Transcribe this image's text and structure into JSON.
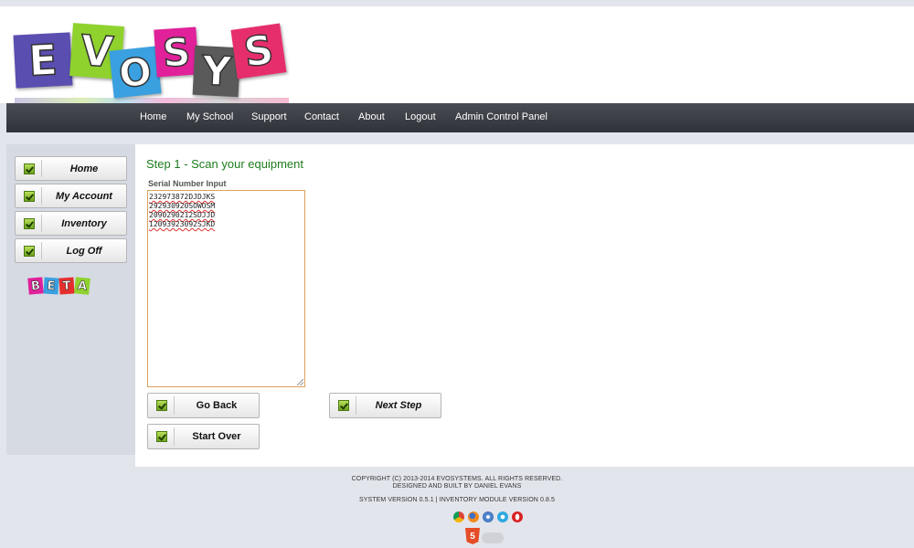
{
  "header": {
    "logo_letters": [
      "E",
      "V",
      "O",
      "S",
      "Y",
      "S"
    ],
    "logo_colors": [
      "#5a4eb0",
      "#8fd22e",
      "#3aa0e0",
      "#e0219a",
      "#5a5a5a",
      "#e72e6d"
    ]
  },
  "nav": {
    "items": [
      "Home",
      "My School",
      "Support",
      "Contact",
      "About",
      "Logout",
      "Admin Control Panel"
    ]
  },
  "sidebar": {
    "items": [
      "Home",
      "My Account",
      "Inventory",
      "Log Off"
    ],
    "beta_letters": [
      "B",
      "E",
      "T",
      "A"
    ],
    "beta_colors": [
      "#e0219a",
      "#3aa0e0",
      "#e72e2e",
      "#8fd22e"
    ]
  },
  "main": {
    "step_title": "Step 1 - Scan your equipment",
    "field_label": "Serial Number Input",
    "serials": [
      "232973872DJDJKS",
      "292930920SOWOSM",
      "2090290212SDJJD",
      "12093923092SJKD"
    ],
    "buttons": {
      "go_back": "Go Back",
      "next_step": "Next Step",
      "start_over": "Start Over"
    }
  },
  "footer": {
    "copyright": "COPYRIGHT (C) 2013-2014 EVOSYSTEMS. ALL RIGHTS RESERVED.",
    "designed_by": "DESIGNED AND BUILT BY DANIEL EVANS",
    "version": "SYSTEM VERSION 0.5.1 | INVENTORY MODULE VERSION 0.8.5",
    "browser_icons": [
      "chrome-icon",
      "firefox-icon",
      "safari-icon",
      "ie-icon",
      "opera-icon"
    ],
    "html5_badge": "5"
  }
}
